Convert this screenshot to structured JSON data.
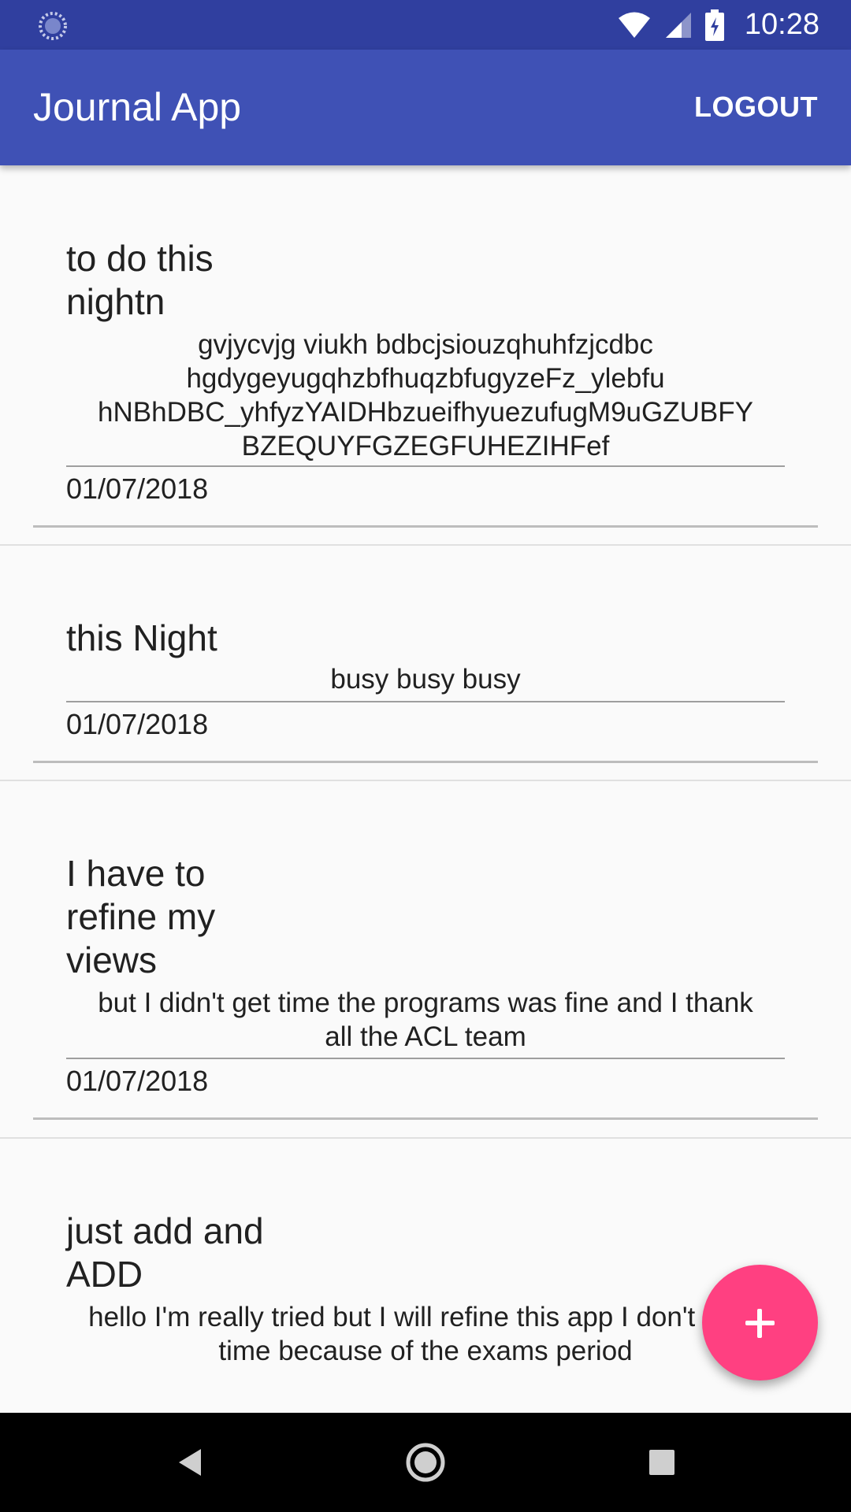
{
  "status_bar": {
    "time": "10:28",
    "icons": [
      "loading-indicator-icon",
      "wifi-icon",
      "cellular-signal-icon",
      "battery-charging-icon"
    ]
  },
  "app_bar": {
    "title": "Journal App",
    "logout_label": "LOGOUT"
  },
  "entries": [
    {
      "title": "to do this\nnightn",
      "body": "gvjycvjg viukh bdbcjsiouzqhuhfzjcdbc\nhgdygeyugqhzbfhuqzbfugyzeFz_ylebfu\nhNBhDBC_yhfyzYAIDHbzueifhyuezufugM9uGZUBFY\nBZEQUYFGZEGFUHEZIHFef",
      "date": "01/07/2018"
    },
    {
      "title": "this Night",
      "body": "busy busy busy",
      "date": "01/07/2018"
    },
    {
      "title": "I have to\nrefine my\nviews",
      "body": "but I didn't get time the programs was fine and I thank\nall the ACL team",
      "date": "01/07/2018"
    },
    {
      "title": "just add and\nADD",
      "body": "hello I'm really tried but I will refine this app  I don't have\ntime because of the exams period",
      "date": ""
    }
  ],
  "fab": {
    "icon": "plus-icon"
  },
  "nav_bar": {
    "icons": [
      "back-icon",
      "home-icon",
      "recents-icon"
    ]
  },
  "colors": {
    "status_bar": "#303f9f",
    "app_bar": "#3f51b5",
    "fab": "#ff4081",
    "background": "#fafafa"
  }
}
